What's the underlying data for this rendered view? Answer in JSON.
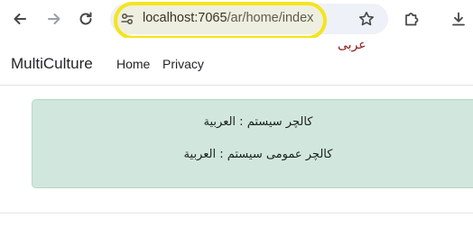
{
  "browser": {
    "url_host": "localhost:7065",
    "url_path": "/ar/home/index",
    "icons": [
      "back-arrow-icon",
      "forward-arrow-icon",
      "reload-icon",
      "site-info-icon",
      "bookmark-star-icon",
      "extensions-icon",
      "download-icon"
    ]
  },
  "navbar": {
    "brand": "MultiCulture",
    "links": [
      "Home",
      "Privacy"
    ],
    "language_link": "عربی"
  },
  "alert": {
    "line1": "کالچر سیستم : العربیة",
    "line2": "کالچر عمومی سیستم : العربیة"
  },
  "colors": {
    "highlight": "#f3e51d",
    "alert_bg": "#d1e7dd",
    "language_link": "#8b1a1a"
  }
}
